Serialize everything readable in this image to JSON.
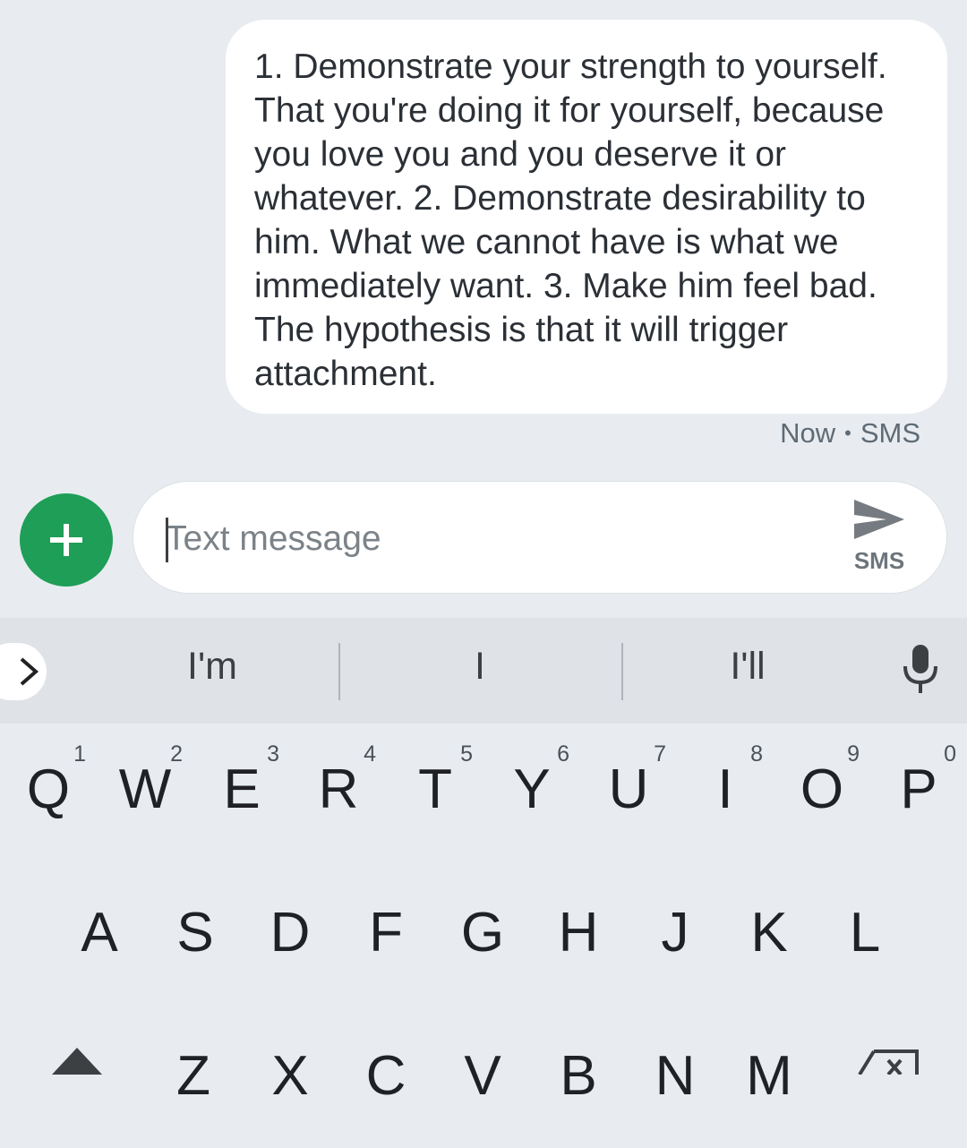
{
  "conversation": {
    "message": "1. Demonstrate your strength to yourself. That you're doing it for yourself, because you love you and you deserve it or whatever. 2. Demonstrate desirability to him. What we cannot have is what we immediately want. 3. Make him feel bad. The hypothesis is that it will trigger attachment.",
    "time": "Now",
    "separator": "•",
    "channel": "SMS"
  },
  "compose": {
    "placeholder": "Text message",
    "value": "",
    "send_label": "SMS",
    "icons": {
      "attach": "plus-icon",
      "send": "send-icon"
    },
    "accent_color": "#1e9e57"
  },
  "keyboard": {
    "expand_icon": "chevron-right-icon",
    "suggestions": [
      "I'm",
      "I",
      "I'll"
    ],
    "voice_icon": "microphone-icon",
    "row1": [
      {
        "key": "Q",
        "hint": "1"
      },
      {
        "key": "W",
        "hint": "2"
      },
      {
        "key": "E",
        "hint": "3"
      },
      {
        "key": "R",
        "hint": "4"
      },
      {
        "key": "T",
        "hint": "5"
      },
      {
        "key": "Y",
        "hint": "6"
      },
      {
        "key": "U",
        "hint": "7"
      },
      {
        "key": "I",
        "hint": "8"
      },
      {
        "key": "O",
        "hint": "9"
      },
      {
        "key": "P",
        "hint": "0"
      }
    ],
    "row2": [
      "A",
      "S",
      "D",
      "F",
      "G",
      "H",
      "J",
      "K",
      "L"
    ],
    "row3": [
      "Z",
      "X",
      "C",
      "V",
      "B",
      "N",
      "M"
    ],
    "shift_icon": "shift-icon",
    "backspace_icon": "backspace-icon"
  }
}
